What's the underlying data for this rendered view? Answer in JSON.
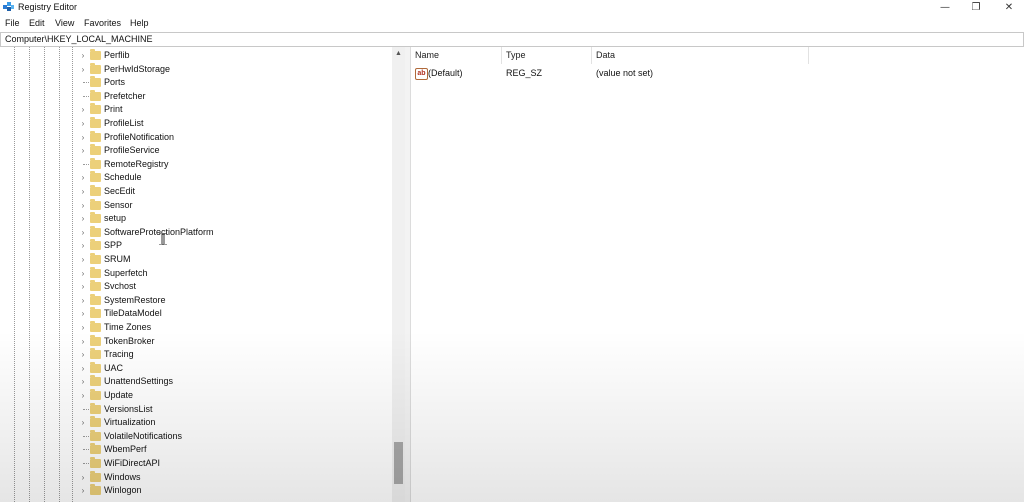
{
  "window": {
    "title": "Registry Editor",
    "controls": {
      "minimize": "—",
      "restore": "❐",
      "close": "✕"
    }
  },
  "menu": [
    "File",
    "Edit",
    "View",
    "Favorites",
    "Help"
  ],
  "address": "Computer\\HKEY_LOCAL_MACHINE",
  "tree": {
    "items": [
      {
        "label": "Perflib",
        "expandable": true
      },
      {
        "label": "PerHwIdStorage",
        "expandable": true
      },
      {
        "label": "Ports",
        "expandable": false
      },
      {
        "label": "Prefetcher",
        "expandable": false
      },
      {
        "label": "Print",
        "expandable": true
      },
      {
        "label": "ProfileList",
        "expandable": true
      },
      {
        "label": "ProfileNotification",
        "expandable": true
      },
      {
        "label": "ProfileService",
        "expandable": true
      },
      {
        "label": "RemoteRegistry",
        "expandable": false
      },
      {
        "label": "Schedule",
        "expandable": true
      },
      {
        "label": "SecEdit",
        "expandable": true
      },
      {
        "label": "Sensor",
        "expandable": true
      },
      {
        "label": "setup",
        "expandable": true
      },
      {
        "label": "SoftwareProtectionPlatform",
        "expandable": true
      },
      {
        "label": "SPP",
        "expandable": true
      },
      {
        "label": "SRUM",
        "expandable": true
      },
      {
        "label": "Superfetch",
        "expandable": true
      },
      {
        "label": "Svchost",
        "expandable": true
      },
      {
        "label": "SystemRestore",
        "expandable": true
      },
      {
        "label": "TileDataModel",
        "expandable": true
      },
      {
        "label": "Time Zones",
        "expandable": true
      },
      {
        "label": "TokenBroker",
        "expandable": true
      },
      {
        "label": "Tracing",
        "expandable": true
      },
      {
        "label": "UAC",
        "expandable": true
      },
      {
        "label": "UnattendSettings",
        "expandable": true
      },
      {
        "label": "Update",
        "expandable": true
      },
      {
        "label": "VersionsList",
        "expandable": false
      },
      {
        "label": "Virtualization",
        "expandable": true
      },
      {
        "label": "VolatileNotifications",
        "expandable": false
      },
      {
        "label": "WbemPerf",
        "expandable": false
      },
      {
        "label": "WiFiDirectAPI",
        "expandable": false
      },
      {
        "label": "Windows",
        "expandable": true
      },
      {
        "label": "Winlogon",
        "expandable": true
      }
    ]
  },
  "list": {
    "columns": {
      "name": "Name",
      "type": "Type",
      "data": "Data"
    },
    "rows": [
      {
        "icon": "ab",
        "name": "(Default)",
        "type": "REG_SZ",
        "data": "(value not set)"
      }
    ]
  },
  "colors": {
    "folder": "#ecd07a",
    "scroll_thumb": "#a8a8a8"
  }
}
